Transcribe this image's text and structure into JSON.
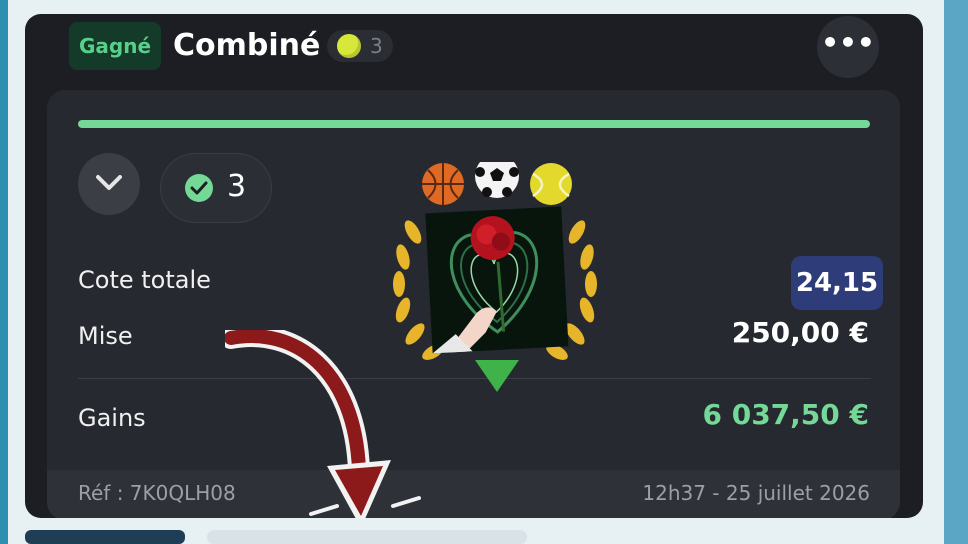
{
  "header": {
    "status_badge": "Gagné",
    "title": "Combiné",
    "sport_count": "3",
    "more_label": "•••"
  },
  "bet": {
    "selections_count": "3",
    "odds_label": "Cote totale",
    "odds_value": "24,15",
    "stake_label": "Mise",
    "stake_value": "250,00 €",
    "gains_label": "Gains",
    "gains_value": "6 037,50 €",
    "progress": 1.0
  },
  "footer": {
    "reference": "Réf : 7K0QLH08",
    "datetime": "12h37 - 25 juillet 2026"
  },
  "icons": {
    "sports": [
      "basketball-icon",
      "soccer-ball-icon",
      "tennis-ball-icon"
    ],
    "status": "check-icon",
    "toggle": "chevron-down-icon"
  },
  "colors": {
    "won_green": "#74d896",
    "odds_badge": "#2e3c7a",
    "card_bg": "#1c1e23"
  }
}
